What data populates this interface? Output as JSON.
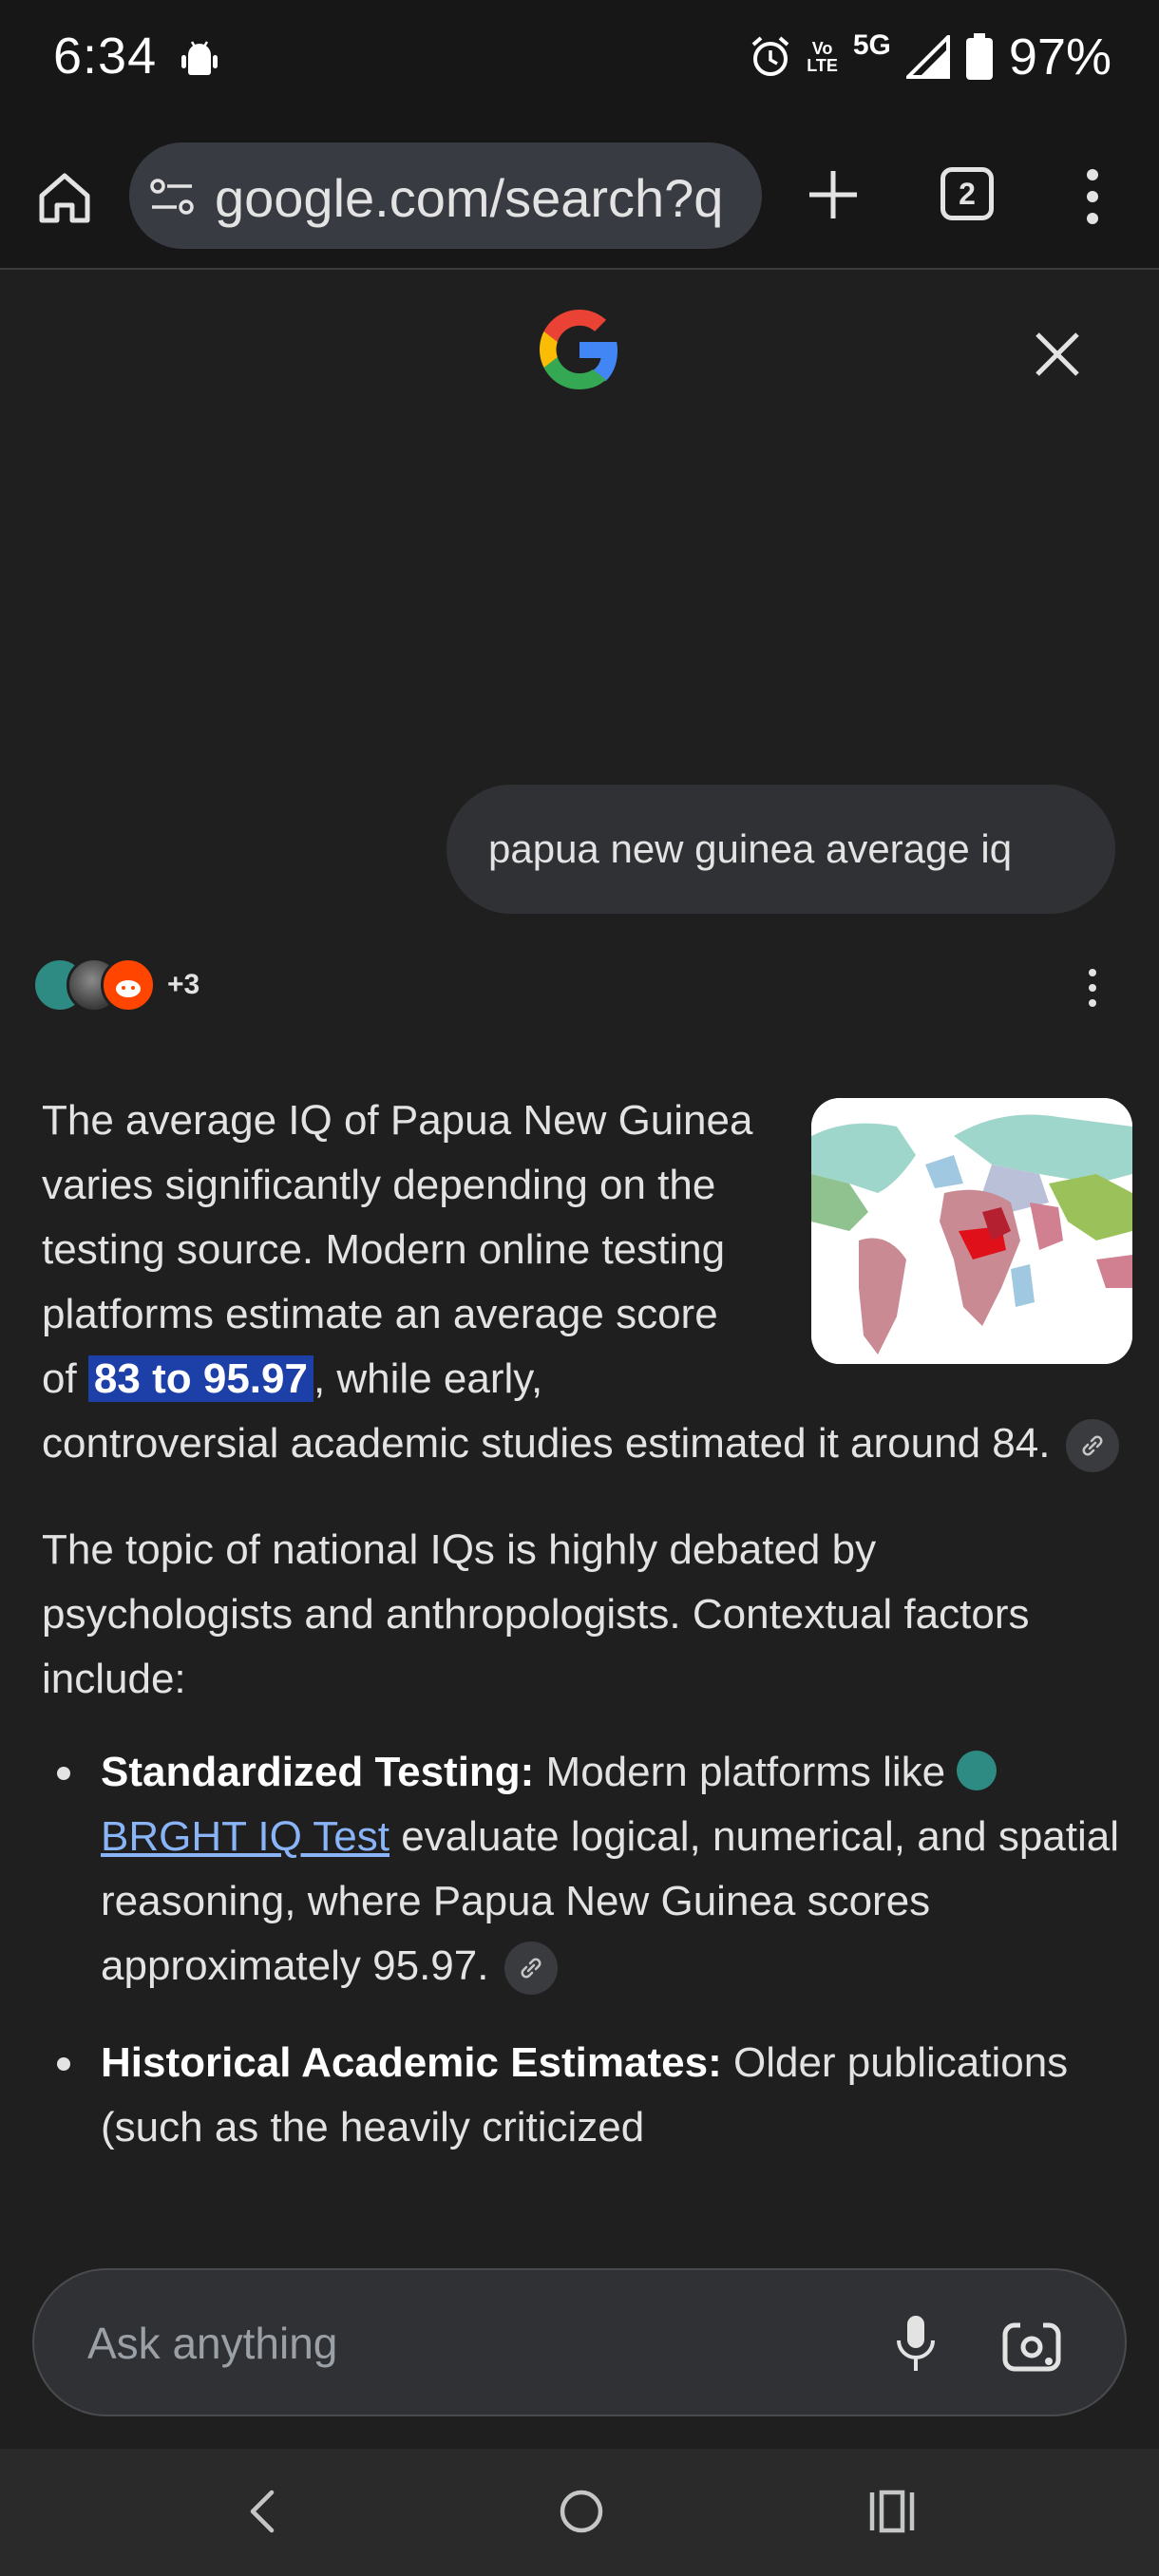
{
  "status_bar": {
    "time": "6:34",
    "network": "5G",
    "volte_label_top": "Vo",
    "volte_label_bottom": "LTE",
    "battery": "97%"
  },
  "toolbar": {
    "url": "google.com/search?q",
    "tab_count": "2"
  },
  "chat": {
    "query": "papua new guinea average iq",
    "source_count": "+3"
  },
  "answer": {
    "p1_before": "The average IQ of Papua New Guinea varies significantly depending on the testing source. Modern online testing platforms estimate an average score of ",
    "p1_highlight": "83 to 95.97",
    "p1_after": ", while early, controversial academic studies estimated it around 84.",
    "p2": "The topic of national IQs is highly debated by psychologists and anthropologists. Contextual factors include:",
    "bullets": [
      {
        "title": "Standardized Testing:",
        "text_before": " Modern platforms like ",
        "link": "BRGHT IQ Test",
        "text_after": " evaluate logical, numerical, and spatial reasoning, where Papua New Guinea scores approximately 95.97."
      },
      {
        "title": "Historical Academic Estimates:",
        "text_before": " Older publications",
        "text_after": "(such as the heavily criticized "
      }
    ]
  },
  "ask_bar": {
    "placeholder": "Ask anything"
  }
}
